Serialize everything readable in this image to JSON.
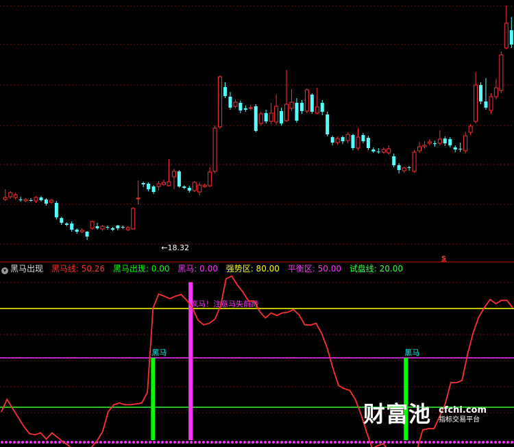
{
  "header": {
    "indicator_name": "黑马出现",
    "items": [
      {
        "label": "黑马线: 50.26",
        "color": "#ff3030"
      },
      {
        "label": "黑马出现: 0.00",
        "color": "#00ff00"
      },
      {
        "label": "黑马: 0.00",
        "color": "#ff33ff"
      },
      {
        "label": "强势区: 80.00",
        "color": "#ffff00"
      },
      {
        "label": "平衡区: 50.00",
        "color": "#ff33ff"
      },
      {
        "label": "试盘线: 20.00",
        "color": "#33ff33"
      }
    ]
  },
  "chart_data": [
    {
      "type": "candlestick",
      "up_color": "#ff3030",
      "down_color": "#54ffff",
      "grid": true,
      "annotations": [
        {
          "text": "←18.32",
          "at_index": 31
        }
      ],
      "candles": [
        [
          291,
          288,
          276,
          293
        ],
        [
          287,
          281,
          279,
          290
        ],
        [
          288,
          284,
          281,
          291
        ],
        [
          291,
          292,
          287,
          294
        ],
        [
          293,
          291,
          289,
          295
        ],
        [
          292,
          292,
          289,
          294
        ],
        [
          293,
          288,
          286,
          296
        ],
        [
          288,
          292,
          286,
          294
        ],
        [
          291,
          297,
          289,
          300
        ],
        [
          295,
          292,
          290,
          297
        ],
        [
          296,
          317,
          293,
          320
        ],
        [
          318,
          325,
          316,
          328
        ],
        [
          326,
          328,
          324,
          330
        ],
        [
          326,
          335,
          323,
          338
        ],
        [
          335,
          338,
          333,
          341
        ],
        [
          338,
          336,
          333,
          340
        ],
        [
          338,
          345,
          337,
          350
        ],
        [
          333,
          323,
          322,
          335
        ],
        [
          330,
          333,
          325,
          335
        ],
        [
          334,
          330,
          328,
          337
        ],
        [
          331,
          332,
          329,
          335
        ],
        [
          333,
          335,
          331,
          337
        ],
        [
          329,
          333,
          328,
          336
        ],
        [
          331,
          332,
          329,
          334
        ],
        [
          335,
          332,
          330,
          337
        ],
        [
          334,
          304,
          302,
          335
        ],
        [
          290,
          289,
          263,
          298
        ],
        [
          267,
          269,
          265,
          273
        ],
        [
          268,
          276,
          266,
          279
        ],
        [
          272,
          280,
          270,
          283
        ],
        [
          272,
          268,
          264,
          278
        ],
        [
          269,
          266,
          262,
          271
        ],
        [
          271,
          265,
          232,
          272
        ],
        [
          258,
          250,
          246,
          276
        ],
        [
          250,
          272,
          248,
          274
        ],
        [
          272,
          274,
          270,
          276
        ],
        [
          274,
          278,
          271,
          281
        ],
        [
          278,
          266,
          264,
          280
        ],
        [
          280,
          270,
          266,
          285
        ],
        [
          272,
          270,
          268,
          274
        ],
        [
          271,
          251,
          244,
          273
        ],
        [
          250,
          187,
          183,
          253
        ],
        [
          185,
          112,
          110,
          188
        ],
        [
          127,
          140,
          120,
          143
        ],
        [
          141,
          157,
          134,
          160
        ],
        [
          155,
          149,
          145,
          158
        ],
        [
          150,
          161,
          147,
          165
        ],
        [
          158,
          160,
          154,
          163
        ],
        [
          158,
          157,
          153,
          161
        ],
        [
          155,
          191,
          152,
          193
        ],
        [
          180,
          166,
          163,
          183
        ],
        [
          165,
          177,
          160,
          180
        ],
        [
          177,
          165,
          150,
          181
        ],
        [
          178,
          155,
          138,
          182
        ],
        [
          162,
          180,
          157,
          183
        ],
        [
          176,
          152,
          102,
          178
        ],
        [
          158,
          149,
          130,
          162
        ],
        [
          150,
          176,
          143,
          179
        ],
        [
          150,
          162,
          146,
          166
        ],
        [
          162,
          131,
          129,
          165
        ],
        [
          138,
          163,
          136,
          166
        ],
        [
          165,
          156,
          128,
          167
        ],
        [
          150,
          163,
          146,
          168
        ],
        [
          167,
          196,
          163,
          199
        ],
        [
          200,
          208,
          198,
          212
        ],
        [
          208,
          202,
          199,
          211
        ],
        [
          200,
          206,
          198,
          210
        ],
        [
          205,
          196,
          193,
          209
        ],
        [
          197,
          216,
          195,
          219
        ],
        [
          216,
          200,
          187,
          219
        ],
        [
          197,
          206,
          194,
          209
        ],
        [
          201,
          216,
          198,
          219
        ],
        [
          218,
          221,
          215,
          223
        ],
        [
          221,
          222,
          216,
          224
        ],
        [
          222,
          218,
          215,
          224
        ],
        [
          223,
          217,
          212,
          226
        ],
        [
          228,
          241,
          224,
          244
        ],
        [
          241,
          248,
          238,
          253
        ],
        [
          249,
          245,
          243,
          252
        ],
        [
          244,
          244,
          242,
          249
        ],
        [
          250,
          222,
          219,
          252
        ],
        [
          220,
          214,
          207,
          223
        ],
        [
          214,
          212,
          206,
          217
        ],
        [
          209,
          207,
          203,
          212
        ],
        [
          209,
          210,
          205,
          214
        ],
        [
          209,
          203,
          190,
          212
        ],
        [
          202,
          209,
          199,
          213
        ],
        [
          203,
          212,
          200,
          215
        ],
        [
          215,
          218,
          212,
          222
        ],
        [
          217,
          218,
          208,
          222
        ],
        [
          220,
          198,
          192,
          224
        ],
        [
          193,
          184,
          181,
          197
        ],
        [
          177,
          124,
          105,
          180
        ],
        [
          124,
          148,
          120,
          152
        ],
        [
          148,
          157,
          114,
          160
        ],
        [
          161,
          141,
          136,
          166
        ],
        [
          141,
          128,
          115,
          145
        ],
        [
          132,
          80,
          75,
          136
        ],
        [
          70,
          34,
          8,
          72
        ],
        [
          44,
          65,
          25,
          70
        ]
      ]
    },
    {
      "type": "line",
      "y_range": [
        0,
        100
      ],
      "reference_lines": [
        {
          "name": "强势区",
          "value": 80,
          "color": "#ffff00"
        },
        {
          "name": "平衡区",
          "value": 50,
          "color": "#ff33ff"
        },
        {
          "name": "试盘线",
          "value": 20,
          "color": "#33ff33"
        }
      ],
      "series": [
        {
          "name": "黑马线",
          "color": "#ff3030",
          "values": [
            17.2,
            24.8,
            19.3,
            13.8,
            8.3,
            3.9,
            3.3,
            4.4,
            0.6,
            4.4,
            1.7,
            -1.2,
            -3.3,
            -7.7,
            -8.8,
            -8.3,
            -4.4,
            -0.5,
            5.0,
            17.2,
            21.5,
            22.6,
            21.5,
            21.5,
            22.0,
            22.6,
            29.1,
            80.2,
            88.8,
            87.5,
            86.0,
            87.5,
            88.5,
            85.0,
            80.5,
            72.9,
            70.1,
            71.0,
            73.5,
            81.3,
            98.1,
            99.7,
            94.3,
            89.9,
            84.5,
            84.5,
            78.1,
            74.3,
            77.3,
            75.8,
            77.3,
            77.8,
            79.3,
            76.1,
            70.1,
            69.9,
            71.0,
            64.9,
            55.9,
            43.8,
            33.3,
            31.3,
            30.2,
            24.8,
            15.7,
            5.0,
            -5.0,
            -3.3,
            -2.2,
            -6.6,
            -8.8,
            -10.4,
            -8.8,
            -8.8,
            -5.4,
            6.1,
            7.0,
            7.0,
            14.3,
            22.0,
            35.0,
            34.9,
            36.3,
            52.6,
            65.5,
            75.0,
            80.7,
            85.5,
            82.9,
            84.9,
            84.9,
            80.5
          ]
        }
      ],
      "signals": [
        {
          "label": "黑马",
          "color": "#00ff00",
          "at_index": 27
        },
        {
          "label": "黑马",
          "color": "#00ff00",
          "at_index": 72
        }
      ],
      "spike": {
        "label": "疯马！注意马失前蹄",
        "color": "#ff33ff",
        "at_index": 36
      }
    }
  ],
  "marker_s": "S",
  "watermark": {
    "big": "财富池",
    "domain": "cfchi.com",
    "sub": "指标交易平台"
  }
}
